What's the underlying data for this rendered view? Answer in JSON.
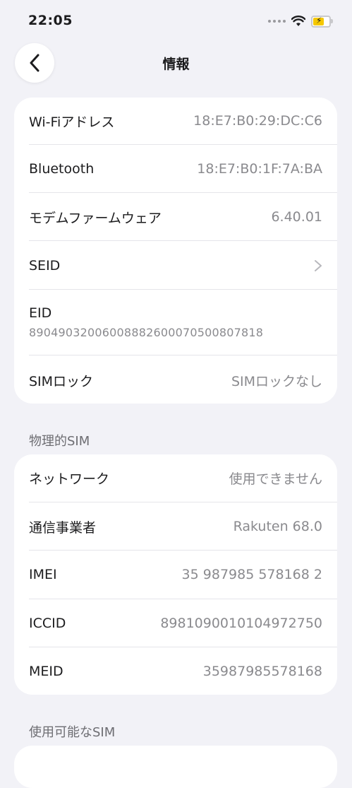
{
  "status_bar": {
    "time": "22:05"
  },
  "nav": {
    "title": "情報"
  },
  "card1": {
    "rows": [
      {
        "label": "Wi-Fiアドレス",
        "value": "18:E7:B0:29:DC:C6"
      },
      {
        "label": "Bluetooth",
        "value": "18:E7:B0:1F:7A:BA"
      },
      {
        "label": "モデムファームウェア",
        "value": "6.40.01"
      },
      {
        "label": "SEID",
        "value": ""
      },
      {
        "label": "EID",
        "value": "89049032006008882600070500807818"
      },
      {
        "label": "SIMロック",
        "value": "SIMロックなし"
      }
    ]
  },
  "section_physical": {
    "title": "物理的SIM"
  },
  "card2": {
    "rows": [
      {
        "label": "ネットワーク",
        "value": "使用できません"
      },
      {
        "label": "通信事業者",
        "value": "Rakuten 68.0"
      },
      {
        "label": "IMEI",
        "value": "35 987985 578168 2"
      },
      {
        "label": "ICCID",
        "value": "8981090010104972750"
      },
      {
        "label": "MEID",
        "value": "35987985578168"
      }
    ]
  },
  "section_available": {
    "title": "使用可能なSIM"
  },
  "colors": {
    "background": "#f2f2f7",
    "card": "#ffffff",
    "secondary_text": "#8a8a8e",
    "battery": "#f5c800"
  }
}
